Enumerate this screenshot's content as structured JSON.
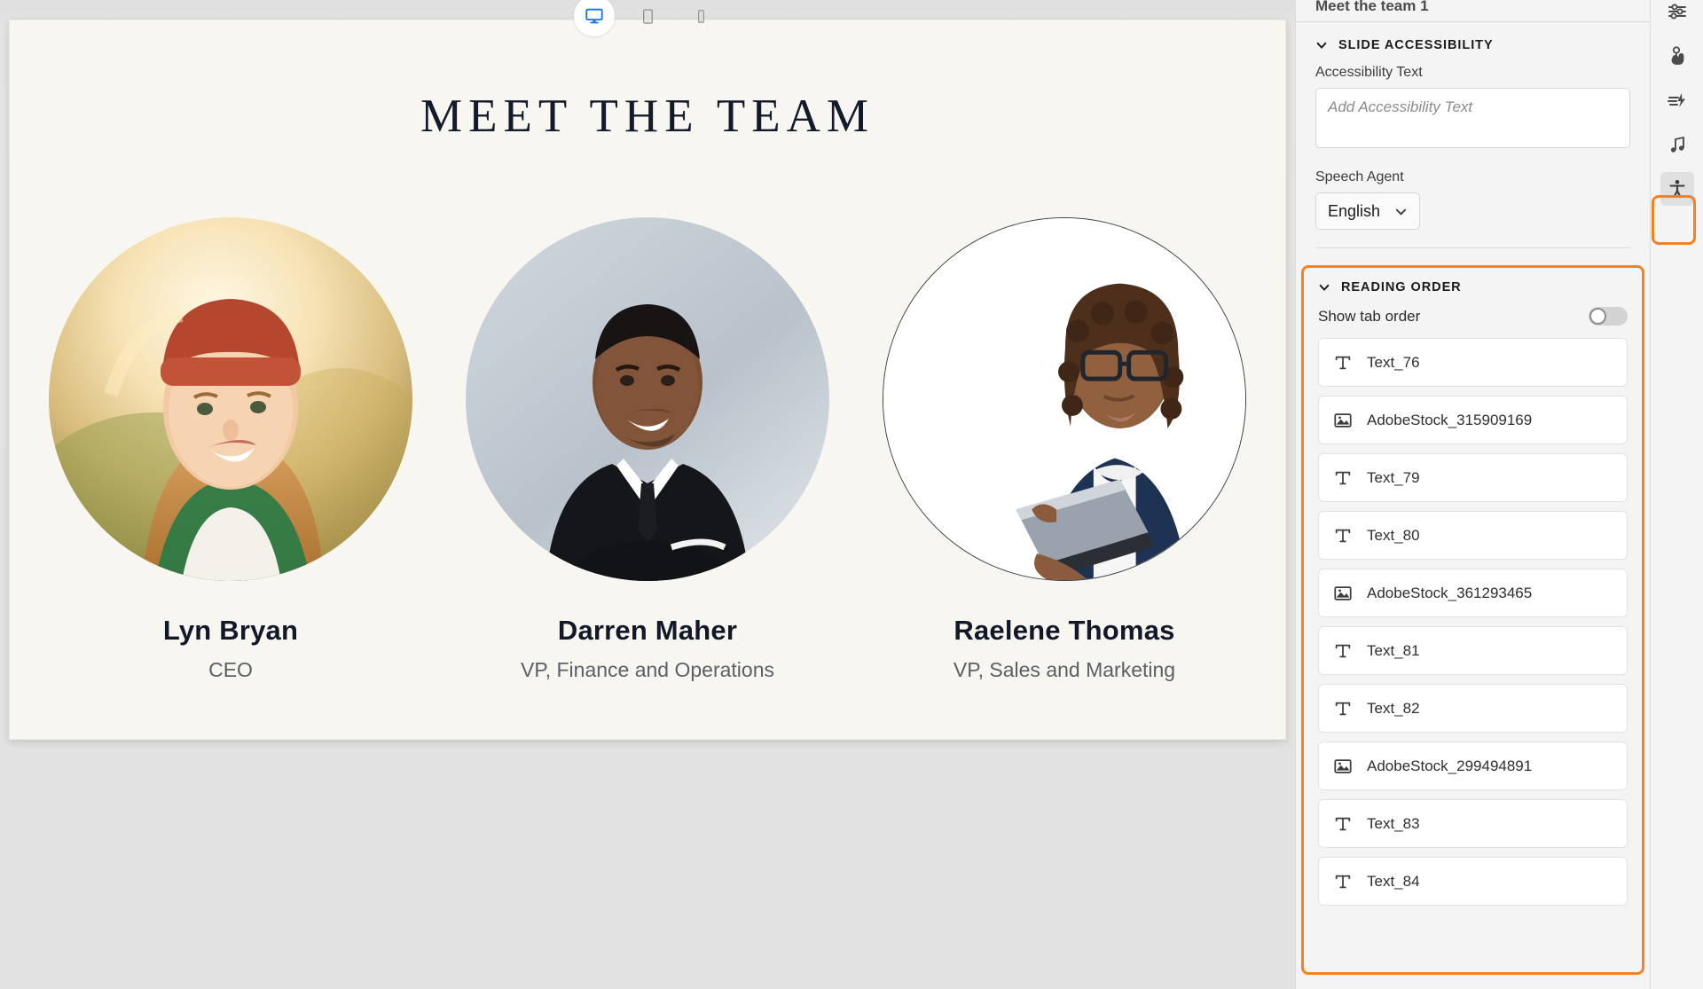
{
  "device_bar": {
    "options": [
      {
        "name": "desktop",
        "icon": "desktop-icon",
        "active": true
      },
      {
        "name": "tablet",
        "icon": "tablet-icon",
        "active": false
      },
      {
        "name": "mobile",
        "icon": "mobile-icon",
        "active": false
      }
    ]
  },
  "slide": {
    "title": "MEET THE TEAM",
    "background": "#f8f6f0",
    "title_color": "#121a2b",
    "members": [
      {
        "name": "Lyn Bryan",
        "role": "CEO",
        "photo": "woman-beanie-sunset-portrait"
      },
      {
        "name": "Darren Maher",
        "role": "VP, Finance and Operations",
        "photo": "man-suit-arms-crossed-portrait"
      },
      {
        "name": "Raelene Thomas",
        "role": "VP, Sales and Marketing",
        "photo": "woman-glasses-folder-portrait"
      }
    ]
  },
  "panel": {
    "clipped_title": "Meet the team 1",
    "slide_accessibility": {
      "heading": "SLIDE ACCESSIBILITY",
      "accessibility_text_label": "Accessibility Text",
      "accessibility_text_value": "",
      "accessibility_text_placeholder": "Add Accessibility Text",
      "speech_agent_label": "Speech Agent",
      "speech_agent_value": "English"
    },
    "reading_order": {
      "heading": "READING ORDER",
      "show_tab_order_label": "Show tab order",
      "show_tab_order_on": false,
      "highlight_color": "#f58220",
      "items": [
        {
          "label": "Text_76",
          "icon": "text-icon"
        },
        {
          "label": "AdobeStock_315909169",
          "icon": "image-icon"
        },
        {
          "label": "Text_79",
          "icon": "text-icon"
        },
        {
          "label": "Text_80",
          "icon": "text-icon"
        },
        {
          "label": "AdobeStock_361293465",
          "icon": "image-icon"
        },
        {
          "label": "Text_81",
          "icon": "text-icon"
        },
        {
          "label": "Text_82",
          "icon": "text-icon"
        },
        {
          "label": "AdobeStock_299494891",
          "icon": "image-icon"
        },
        {
          "label": "Text_83",
          "icon": "text-icon"
        },
        {
          "label": "Text_84",
          "icon": "text-icon"
        }
      ]
    }
  },
  "icon_rail": {
    "items": [
      {
        "name": "properties-sliders-icon",
        "selected": false
      },
      {
        "name": "interactions-hand-icon",
        "selected": false
      },
      {
        "name": "motion-effects-icon",
        "selected": false
      },
      {
        "name": "audio-music-icon",
        "selected": false
      },
      {
        "name": "accessibility-person-icon",
        "selected": true
      }
    ]
  }
}
